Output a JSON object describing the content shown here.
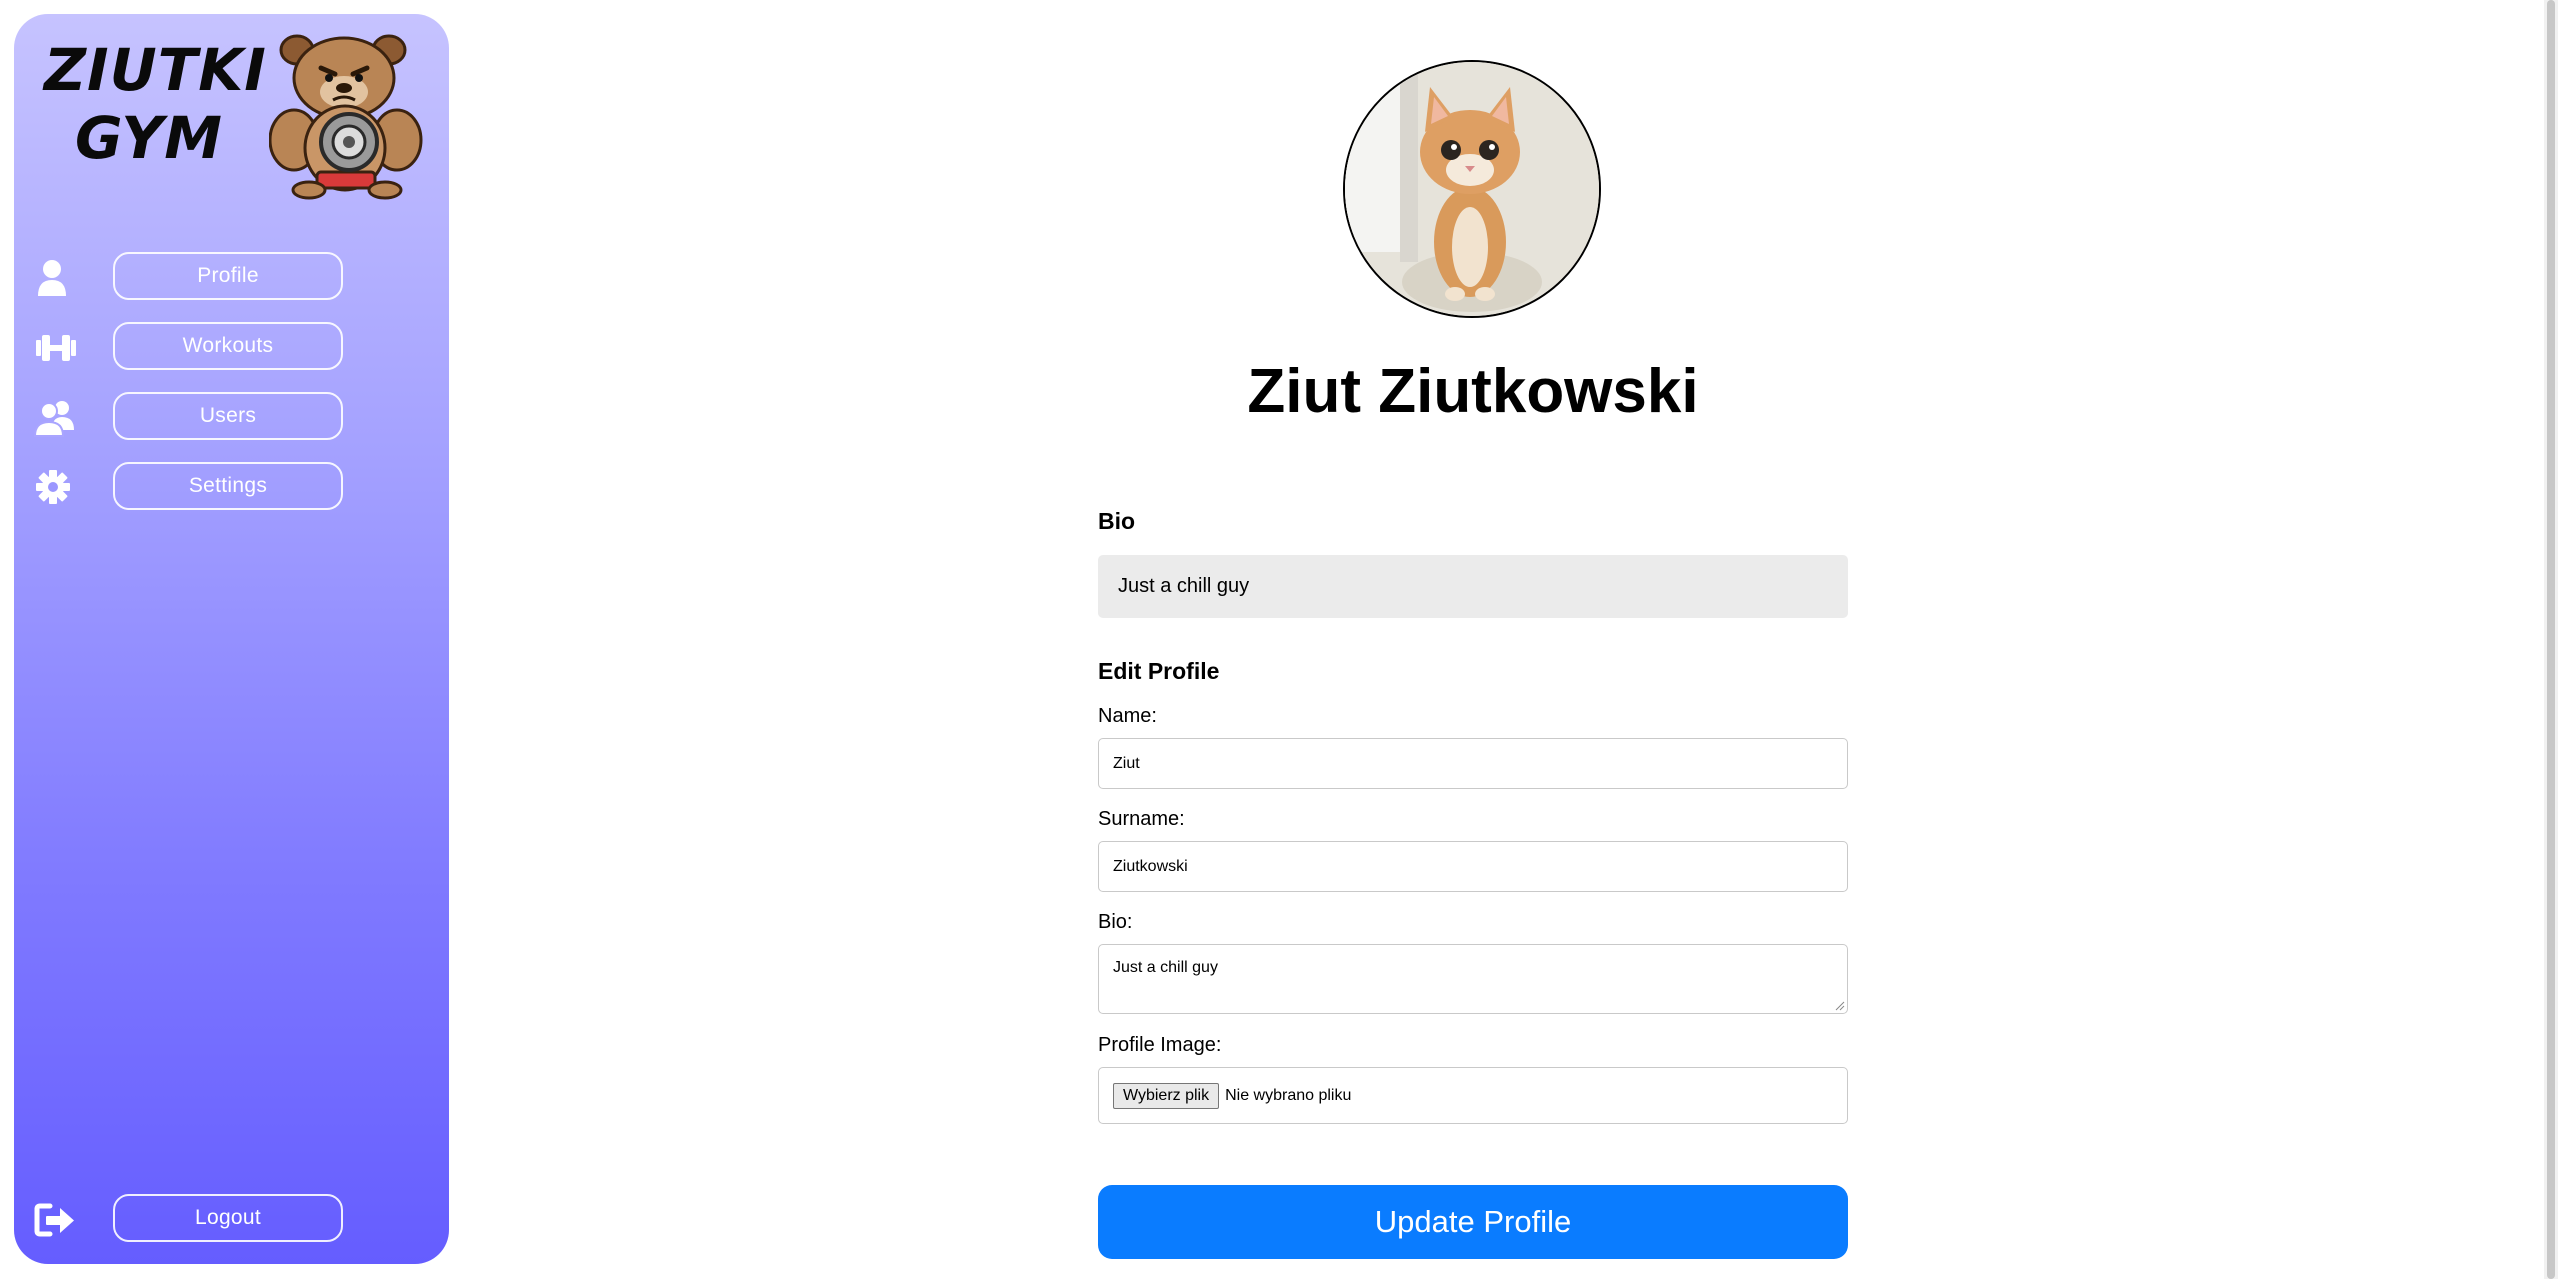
{
  "sidebar": {
    "logo": {
      "line1": "ZIUTKI",
      "line2": "GYM"
    },
    "mascot_icon": "bulldog-mascot-with-weight",
    "items": [
      {
        "label": "Profile",
        "icon": "user-icon"
      },
      {
        "label": "Workouts",
        "icon": "dumbbell-icon"
      },
      {
        "label": "Users",
        "icon": "users-icon"
      },
      {
        "label": "Settings",
        "icon": "gear-icon"
      }
    ],
    "logout": {
      "label": "Logout",
      "icon": "sign-out-icon"
    }
  },
  "profile": {
    "avatar": "kitten-photo",
    "name": "Ziut Ziutkowski",
    "bio_title": "Bio",
    "bio_text": "Just a chill guy"
  },
  "edit_form": {
    "title": "Edit Profile",
    "name_label": "Name:",
    "name_value": "Ziut",
    "surname_label": "Surname:",
    "surname_value": "Ziutkowski",
    "bio_label": "Bio:",
    "bio_value": "Just a chill guy",
    "image_label": "Profile Image:",
    "file_button": "Wybierz plik",
    "file_status": "Nie wybrano pliku",
    "submit": "Update Profile"
  },
  "colors": {
    "sidebar_top": "#c6c3ff",
    "sidebar_bottom": "#655dff",
    "accent": "#0a7cff"
  }
}
